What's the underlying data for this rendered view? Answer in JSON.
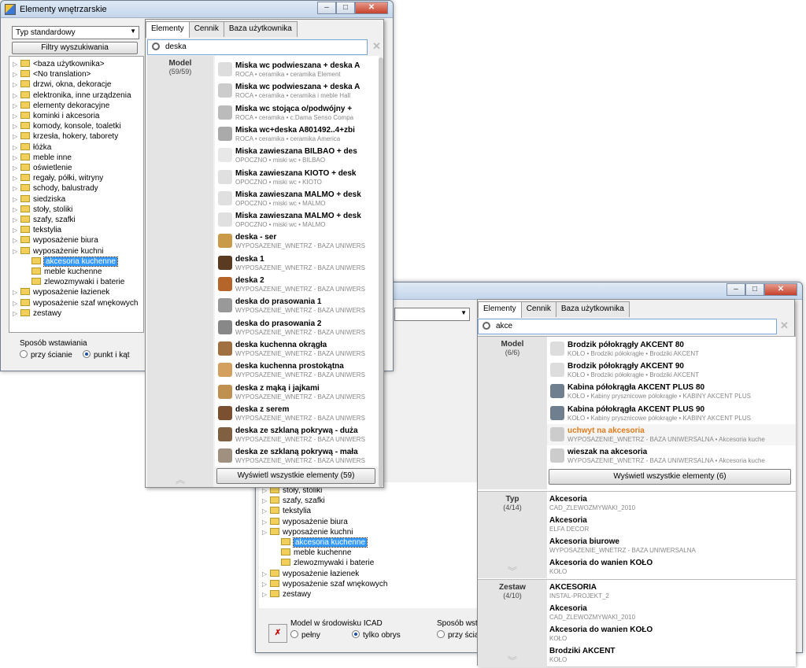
{
  "colors": {
    "accent": "#3399ff",
    "highlight_item": "#e07b1a"
  },
  "win1": {
    "title": "Elementy wnętrzarskie",
    "combo": "Typ standardowy",
    "filter_btn": "Filtry wyszukiwania",
    "tree": [
      "<baza użytkownika>",
      "<No translation>",
      "drzwi, okna, dekoracje",
      "elektronika, inne urządzenia",
      "elementy dekoracyjne",
      "kominki i akcesoria",
      "komody, konsole, toaletki",
      "krzesła, hokery, taborety",
      "łóżka",
      "meble inne",
      "oświetlenie",
      "regały, półki, witryny",
      "schody, balustrady",
      "siedziska",
      "stoły, stoliki",
      "szafy, szafki",
      "tekstylia",
      "wyposażenie biura",
      "wyposażenie kuchni",
      "akcesoria kuchenne",
      "meble kuchenne",
      "zlewozmywaki i baterie",
      "wyposażenie łazienek",
      "wyposażenie szaf wnękowych",
      "zestawy"
    ],
    "insert_label": "Sposób wstawiania",
    "opt_wall": "przy ścianie",
    "opt_point": "punkt i kąt"
  },
  "popup1": {
    "tabs": [
      "Elementy",
      "Cennik",
      "Baza użytkownika"
    ],
    "search": "deska",
    "section": "Model",
    "count": "(59/59)",
    "items": [
      {
        "name": "Miska wc podwieszana + deska A",
        "sub": "ROCA • ceramika • ceramika Element"
      },
      {
        "name": "Miska wc podwieszana + deska A",
        "sub": "ROCA • ceramika • ceramika i meble Hall"
      },
      {
        "name": "Miska wc stojąca o/podwójny +",
        "sub": "ROCA • ceramika • c.Dama Senso Compa"
      },
      {
        "name": "Miska wc+deska A801492..4+zbi",
        "sub": "ROCA • ceramika • ceramika America"
      },
      {
        "name": "Miska zawieszana BILBAO + des",
        "sub": "OPOCZNO • miski wc • BILBAO"
      },
      {
        "name": "Miska zawieszana KIOTO + desk",
        "sub": "OPOCZNO • miski wc • KIOTO"
      },
      {
        "name": "Miska zawieszana MALMO + desk",
        "sub": "OPOCZNO • miski wc • MALMO"
      },
      {
        "name": "Miska zawieszana MALMO + desk",
        "sub": "OPOCZNO • miski wc • MALMO"
      },
      {
        "name": "deska - ser",
        "sub": "WYPOSAZENIE_WNETRZ - BAZA UNIWERS"
      },
      {
        "name": "deska 1",
        "sub": "WYPOSAZENIE_WNETRZ - BAZA UNIWERS"
      },
      {
        "name": "deska 2",
        "sub": "WYPOSAZENIE_WNETRZ - BAZA UNIWERS"
      },
      {
        "name": "deska do prasowania 1",
        "sub": "WYPOSAZENIE_WNETRZ - BAZA UNIWERS"
      },
      {
        "name": "deska do prasowania 2",
        "sub": "WYPOSAZENIE_WNETRZ - BAZA UNIWERS"
      },
      {
        "name": "deska kuchenna okrągła",
        "sub": "WYPOSAZENIE_WNETRZ - BAZA UNIWERS"
      },
      {
        "name": "deska kuchenna prostokątna",
        "sub": "WYPOSAZENIE_WNETRZ - BAZA UNIWERS"
      },
      {
        "name": "deska z mąką i jajkami",
        "sub": "WYPOSAZENIE_WNETRZ - BAZA UNIWERS"
      },
      {
        "name": "deska z serem",
        "sub": "WYPOSAZENIE_WNETRZ - BAZA UNIWERS"
      },
      {
        "name": "deska ze szklaną pokrywą - duża",
        "sub": "WYPOSAZENIE_WNETRZ - BAZA UNIWERS"
      },
      {
        "name": "deska ze szklaną pokrywą - mała",
        "sub": "WYPOSAZENIE_WNETRZ - BAZA UNIWERS"
      }
    ],
    "show_all": "Wyświetl wszystkie elementy (59)"
  },
  "win2": {
    "tree": [
      "stoły, stoliki",
      "szafy, szafki",
      "tekstylia",
      "wyposażenie biura",
      "wyposażenie kuchni",
      "akcesoria kuchenne",
      "meble kuchenne",
      "zlewozmywaki i baterie",
      "wyposażenie łazienek",
      "wyposażenie szaf wnękowych",
      "zestawy"
    ],
    "model_label": "Model w środowisku ICAD",
    "opt_full": "pełny",
    "opt_outline": "tylko obrys",
    "insert_label": "Sposób wstawiania",
    "opt_wall": "przy ścian"
  },
  "popup2": {
    "tabs": [
      "Elementy",
      "Cennik",
      "Baza użytkownika"
    ],
    "search": "akce",
    "model": {
      "label": "Model",
      "count": "(6/6)",
      "items": [
        {
          "name": "Brodzik półokrągły AKCENT 80",
          "sub": "KOŁO • Brodziki półokrągłe • Brodziki AKCENT"
        },
        {
          "name": "Brodzik półokrągły AKCENT 90",
          "sub": "KOŁO • Brodziki półokrągłe • Brodziki AKCENT"
        },
        {
          "name": "Kabina półokrągła AKCENT PLUS 80",
          "sub": "KOŁO • Kabiny prysznicowe półokrągłe • KABINY AKCENT PLUS"
        },
        {
          "name": "Kabina półokrągła AKCENT PLUS 90",
          "sub": "KOŁO • Kabiny prysznicowe półokrągłe • KABINY AKCENT PLUS"
        },
        {
          "name": "uchwyt na akcesoria",
          "sub": "WYPOSAZENIE_WNETRZ - BAZA UNIWERSALNA • Akcesoria kuche"
        },
        {
          "name": "wieszak na akcesoria",
          "sub": "WYPOSAZENIE_WNETRZ - BAZA UNIWERSALNA • Akcesoria kuche"
        }
      ],
      "show_all": "Wyświetl wszystkie elementy (6)"
    },
    "typ": {
      "label": "Typ",
      "count": "(4/14)",
      "items": [
        {
          "name": "Akcesoria",
          "sub": "CAD_ZLEWOZMYWAKI_2010"
        },
        {
          "name": "Akcesoria",
          "sub": "ELFA DECOR"
        },
        {
          "name": "Akcesoria biurowe",
          "sub": "WYPOSAZENIE_WNETRZ - BAZA UNIWERSALNA"
        },
        {
          "name": "Akcesoria do wanien KOŁO",
          "sub": "KOŁO"
        }
      ]
    },
    "zestaw": {
      "label": "Zestaw",
      "count": "(4/10)",
      "items": [
        {
          "name": "AKCESORIA",
          "sub": "INSTAL-PROJEKT_2"
        },
        {
          "name": "Akcesoria",
          "sub": "CAD_ZLEWOZMYWAKI_2010"
        },
        {
          "name": "Akcesoria do wanien KOŁO",
          "sub": "KOŁO"
        },
        {
          "name": "Brodziki AKCENT",
          "sub": "KOŁO"
        }
      ]
    }
  }
}
